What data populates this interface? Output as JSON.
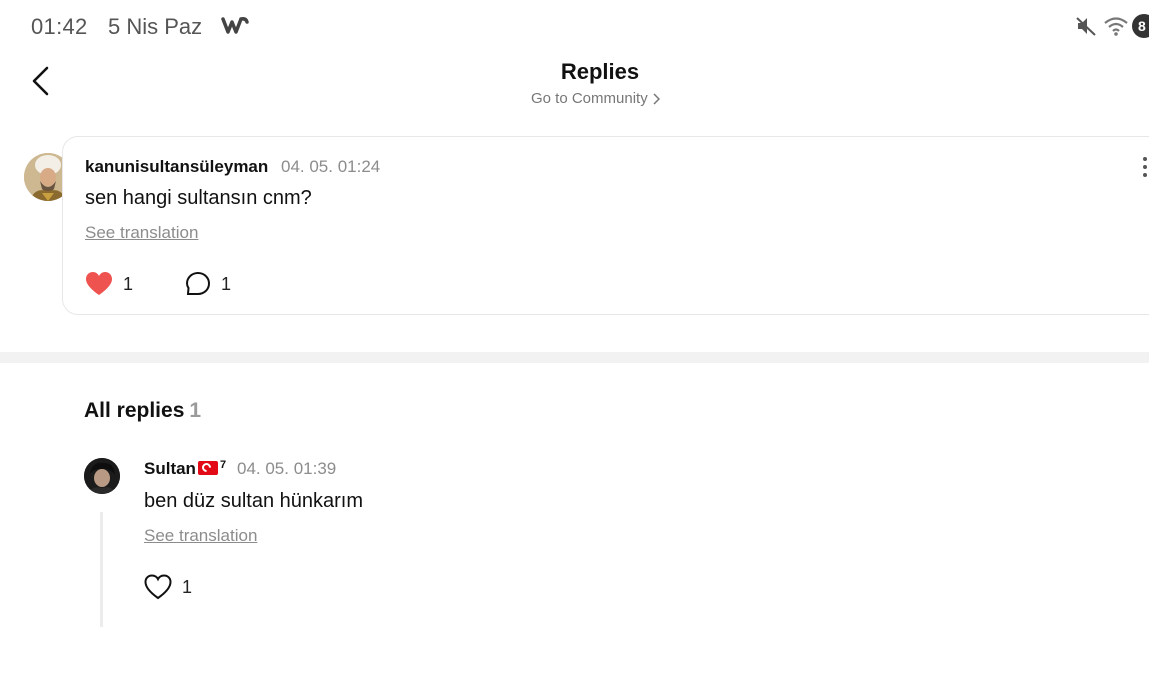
{
  "status_bar": {
    "time": "01:42",
    "date": "5 Nis Paz",
    "app_icon": "webtoon-w-icon",
    "battery_level": "8"
  },
  "header": {
    "title": "Replies",
    "community_link": "Go to Community"
  },
  "comment": {
    "username": "kanunisultansüleyman",
    "timestamp": "04. 05. 01:24",
    "text": "sen hangi sultansın cnm?",
    "translate_label": "See translation",
    "likes": "1",
    "liked": true,
    "replies": "1"
  },
  "replies_section": {
    "title": "All replies",
    "count": "1"
  },
  "replies": [
    {
      "username": "Sultan",
      "username_suffix": "7",
      "timestamp": "04. 05. 01:39",
      "text": "ben düz sultan hünkarım",
      "translate_label": "See translation",
      "likes": "1",
      "liked": false
    }
  ],
  "colors": {
    "like_active": "#ef5350",
    "muted_text": "#8c8c8c",
    "divider": "#f2f2f2"
  }
}
